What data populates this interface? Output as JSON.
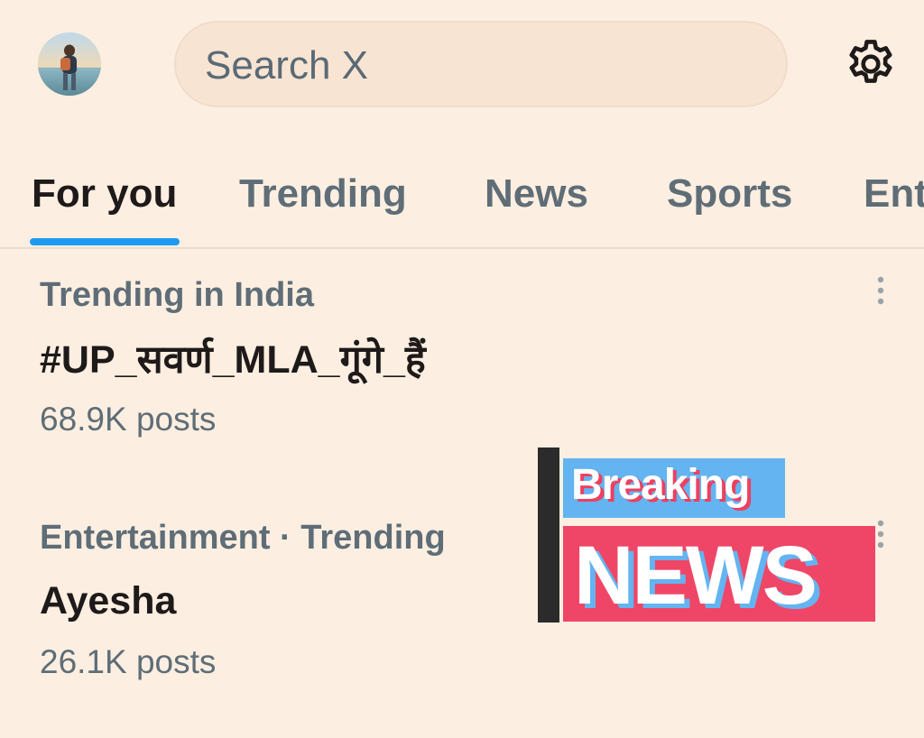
{
  "header": {
    "search_placeholder": "Search X",
    "avatar_icon": "avatar",
    "settings_icon": "gear-icon"
  },
  "tabs": [
    {
      "label": "For you",
      "active": true
    },
    {
      "label": "Trending",
      "active": false
    },
    {
      "label": "News",
      "active": false
    },
    {
      "label": "Sports",
      "active": false
    },
    {
      "label": "Ent",
      "active": false
    }
  ],
  "trends": [
    {
      "meta": "Trending in India",
      "title": "#UP_सवर्ण_MLA_गूंगे_हैं",
      "posts": "68.9K posts"
    },
    {
      "meta": "Entertainment · Trending",
      "title": "Ayesha",
      "posts": "26.1K posts"
    }
  ],
  "promo": {
    "breaking": "Breaking",
    "news": "NEWS"
  },
  "colors": {
    "background": "#fcefe1",
    "accent": "#1d9bf0",
    "muted_text": "#5f6d77",
    "primary_text": "#1f1a1a",
    "breaking_blue": "#63b4f1",
    "news_red": "#ef4667"
  }
}
